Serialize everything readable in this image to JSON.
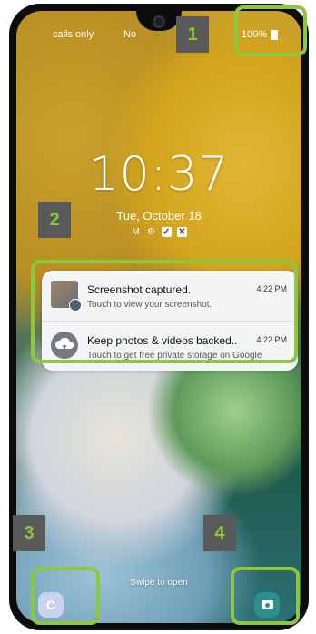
{
  "status_bar": {
    "carrier": "calls only",
    "network_short": "No",
    "battery": "100%"
  },
  "lock_screen": {
    "time": "10:37",
    "date": "Tue, October 18",
    "mini_icons": [
      "M",
      "⚙",
      "✓",
      "✕"
    ]
  },
  "notifications": [
    {
      "title": "Screenshot captured.",
      "time": "4:22 PM",
      "subtitle": "Touch to view your screenshot."
    },
    {
      "title": "Keep photos & videos backed..",
      "time": "4:22 PM",
      "subtitle": "Touch to get free private storage on Google"
    }
  ],
  "footer": {
    "swipe_text": "Swipe to open",
    "left_shortcut_glyph": "C"
  },
  "annotations": [
    "1",
    "2",
    "3",
    "4"
  ],
  "colors": {
    "annotation_green": "#8dc63f",
    "annotation_box": "#595959",
    "camera_shortcut": "#2b8f8d",
    "left_shortcut": "#c9d3ec"
  }
}
